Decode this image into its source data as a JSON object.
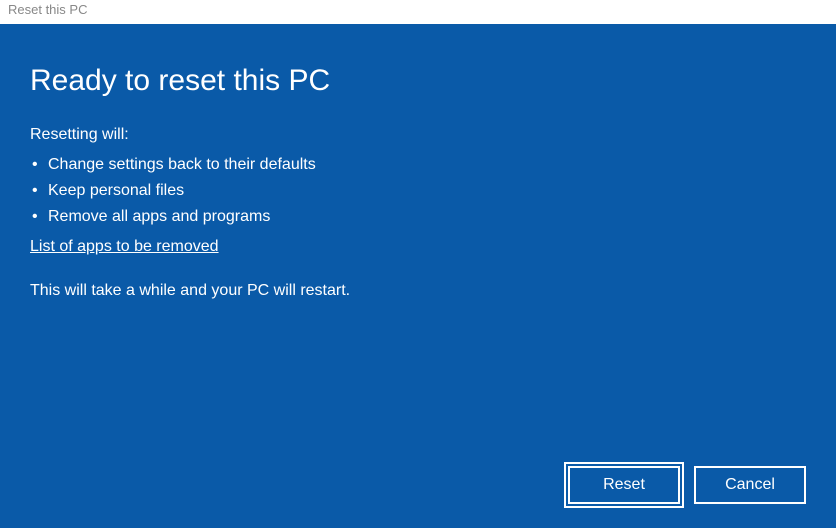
{
  "window": {
    "title": "Reset this PC"
  },
  "main": {
    "heading": "Ready to reset this PC",
    "subheading": "Resetting will:",
    "bullets": {
      "0": "Change settings back to their defaults",
      "1": "Keep personal files",
      "2": "Remove all apps and programs"
    },
    "link_label": "List of apps to be removed",
    "note": "This will take a while and your PC will restart."
  },
  "buttons": {
    "reset": "Reset",
    "cancel": "Cancel"
  }
}
